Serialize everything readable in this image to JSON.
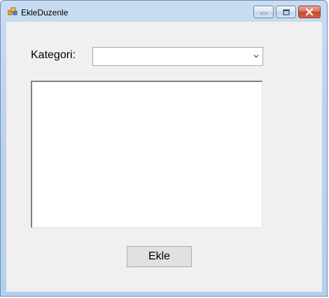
{
  "window": {
    "title": "EkleDuzenle"
  },
  "icons": {
    "app": "app-icon",
    "minimize": "minimize-icon",
    "maximize": "maximize-icon",
    "close": "close-icon",
    "dropdown": "chevron-down-icon"
  },
  "form": {
    "kategori_label": "Kategori:",
    "kategori_value": "",
    "list_items": [],
    "ekle_button": "Ekle"
  },
  "colors": {
    "close_accent": "#c5452a",
    "window_frame": "#bcd3ee",
    "client_bg": "#f0f0f0"
  }
}
